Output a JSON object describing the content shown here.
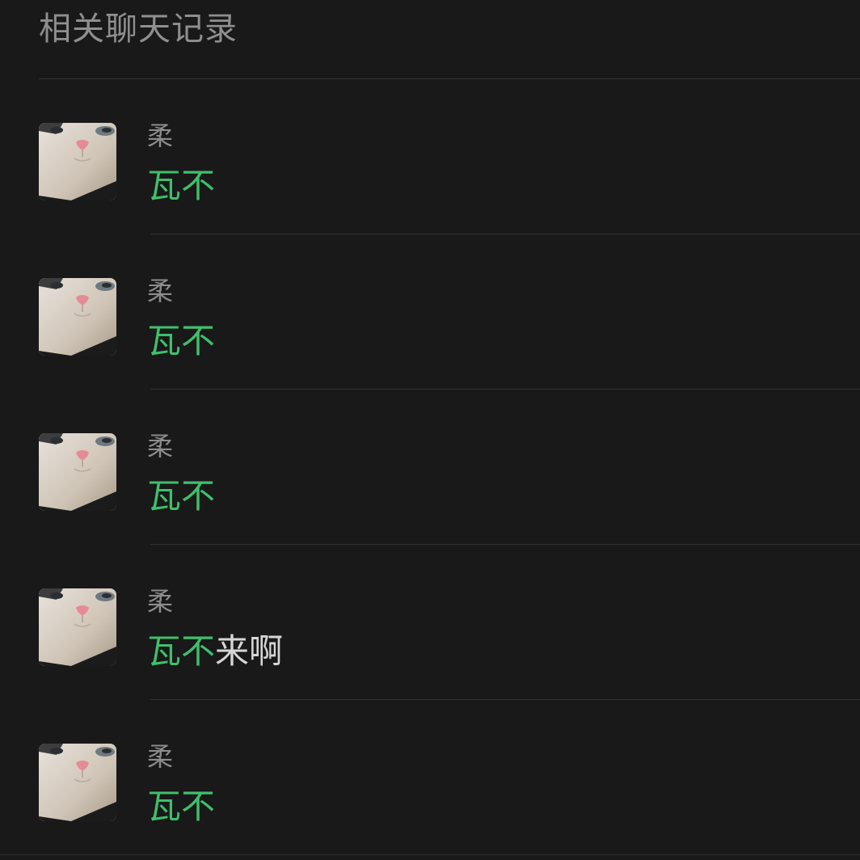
{
  "header": {
    "title": "相关聊天记录"
  },
  "results": [
    {
      "sender": "柔",
      "highlight": "瓦不",
      "rest": "",
      "avatar_icon": "cat-face-avatar"
    },
    {
      "sender": "柔",
      "highlight": "瓦不",
      "rest": "",
      "avatar_icon": "cat-face-avatar"
    },
    {
      "sender": "柔",
      "highlight": "瓦不",
      "rest": "",
      "avatar_icon": "cat-face-avatar"
    },
    {
      "sender": "柔",
      "highlight": "瓦不",
      "rest": "来啊",
      "avatar_icon": "cat-face-avatar"
    },
    {
      "sender": "柔",
      "highlight": "瓦不",
      "rest": "",
      "avatar_icon": "cat-face-avatar"
    }
  ],
  "colors": {
    "background": "#191919",
    "highlight": "#3fbf6b",
    "text": "#d6d6d6",
    "muted": "#8c8c8c"
  }
}
